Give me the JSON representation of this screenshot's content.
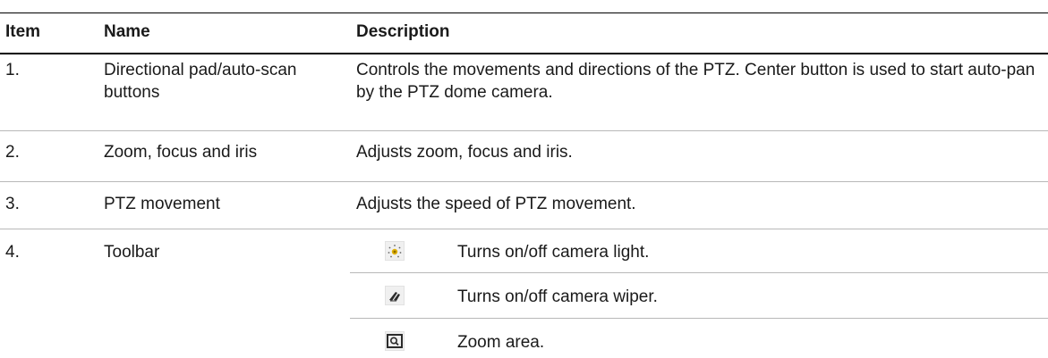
{
  "table": {
    "headers": {
      "item": "Item",
      "name": "Name",
      "description": "Description"
    },
    "rows": [
      {
        "item": "1.",
        "name": "Directional pad/auto-scan buttons",
        "description": "Controls the movements and directions of the PTZ. Center button is used to start auto-pan by the PTZ dome camera."
      },
      {
        "item": "2.",
        "name": "Zoom, focus and iris",
        "description": "Adjusts zoom, focus and iris."
      },
      {
        "item": "3.",
        "name": "PTZ movement",
        "description": "Adjusts the speed of PTZ movement."
      },
      {
        "item": "4.",
        "name": "Toolbar",
        "toolbar_entries": [
          {
            "icon": "light-icon",
            "description": "Turns on/off camera light."
          },
          {
            "icon": "wiper-icon",
            "description": "Turns on/off camera wiper."
          },
          {
            "icon": "zoom-area-icon",
            "description": "Zoom area."
          }
        ]
      }
    ]
  },
  "colors": {
    "rule_dark": "#000000",
    "rule_light": "#b8b8b8",
    "text": "#1a1a1a",
    "icon_bg": "#f0f0f0"
  }
}
